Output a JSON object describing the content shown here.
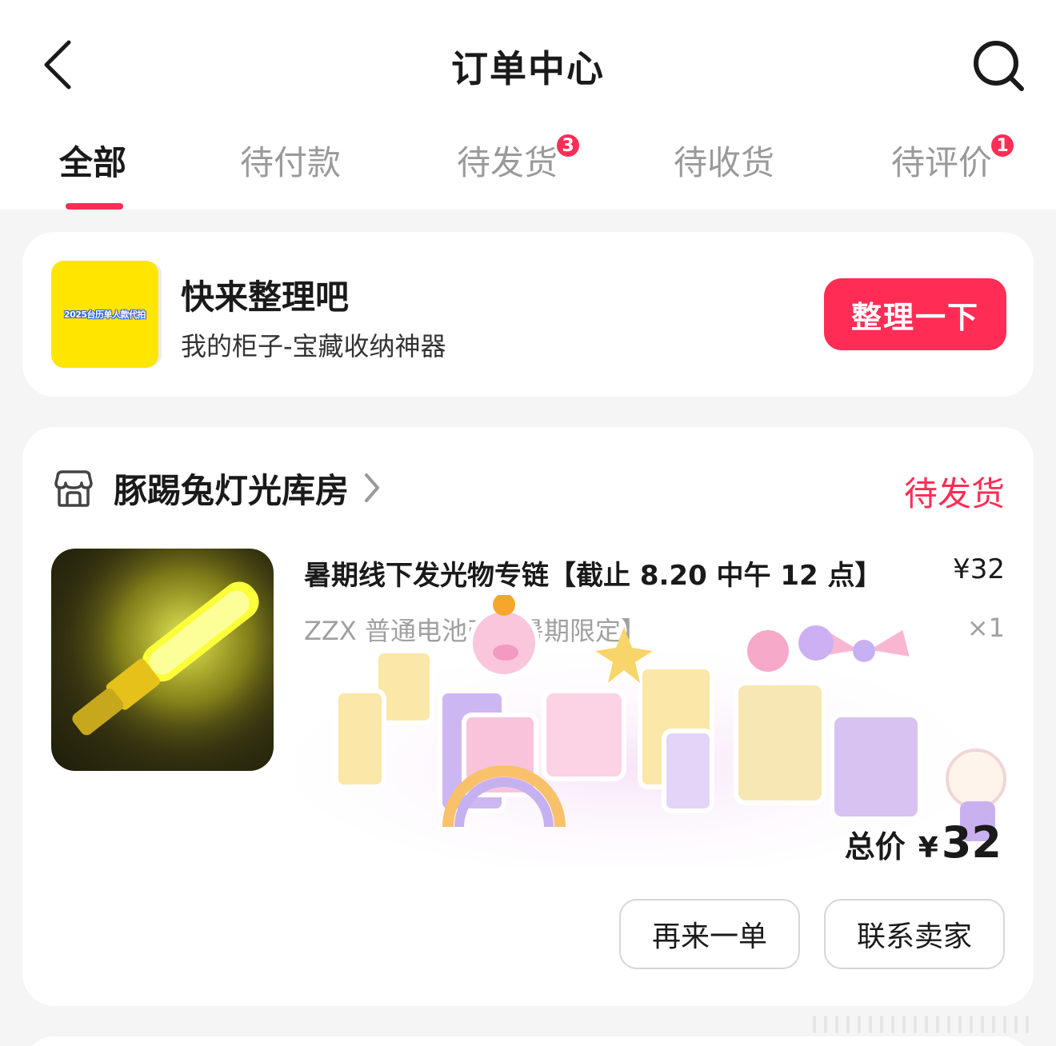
{
  "header": {
    "title": "订单中心",
    "back_icon": "chevron-left-icon",
    "search_icon": "search-icon"
  },
  "tabs": [
    {
      "label": "全部",
      "active": true
    },
    {
      "label": "待付款"
    },
    {
      "label": "待发货",
      "badge": "3"
    },
    {
      "label": "待收货"
    },
    {
      "label": "待评价",
      "badge": "1"
    }
  ],
  "promo": {
    "thumb_text": "2025台历单人款代拍",
    "title": "快来整理吧",
    "subtitle": "我的柜子-宝藏收纳神器",
    "button_label": "整理一下"
  },
  "order": {
    "store_name": "豚踢兔灯光库房",
    "status": "待发货",
    "product_title": "暑期线下发光物专链【截止 8.20 中午 12 点】",
    "product_price": "¥32",
    "product_spec": "ZZX 普通电池改【暑期限定】",
    "product_qty": "×1",
    "total_label": "总价",
    "total_currency": "¥",
    "total_amount": "32",
    "buttons": {
      "reorder": "再来一单",
      "contact": "联系卖家"
    }
  },
  "colors": {
    "accent": "#ff2d55",
    "text_primary": "#1a1a1a",
    "text_secondary": "#9a9a9a",
    "background": "#f5f5f5"
  }
}
